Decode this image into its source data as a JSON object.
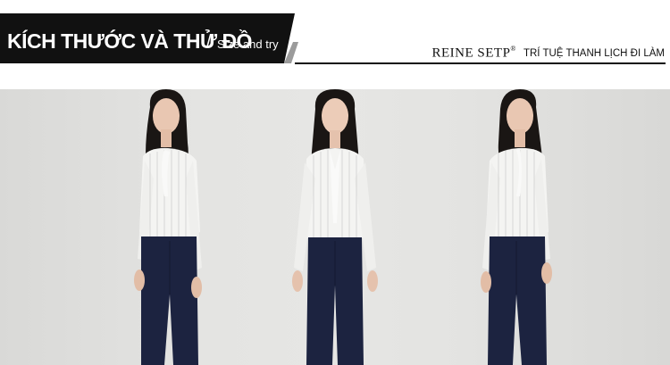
{
  "header": {
    "title_vi": "KÍCH THƯỚC VÀ THỬ ĐỒ",
    "separator": "/",
    "title_en": "Size and try",
    "brand_name": "REINE SETP",
    "brand_reg": "®",
    "brand_tagline": "TRÍ TUỆ THANH LỊCH ĐI LÀM"
  },
  "photo": {
    "models": [
      {
        "pose": "side-left-view"
      },
      {
        "pose": "front-view"
      },
      {
        "pose": "side-right-view"
      }
    ]
  },
  "colors": {
    "title_bg": "#111111",
    "accent_gray": "#9b9b9b",
    "pants": "#1c2340",
    "blouse": "#f4f4f2",
    "backdrop": "#e4e4e2"
  }
}
